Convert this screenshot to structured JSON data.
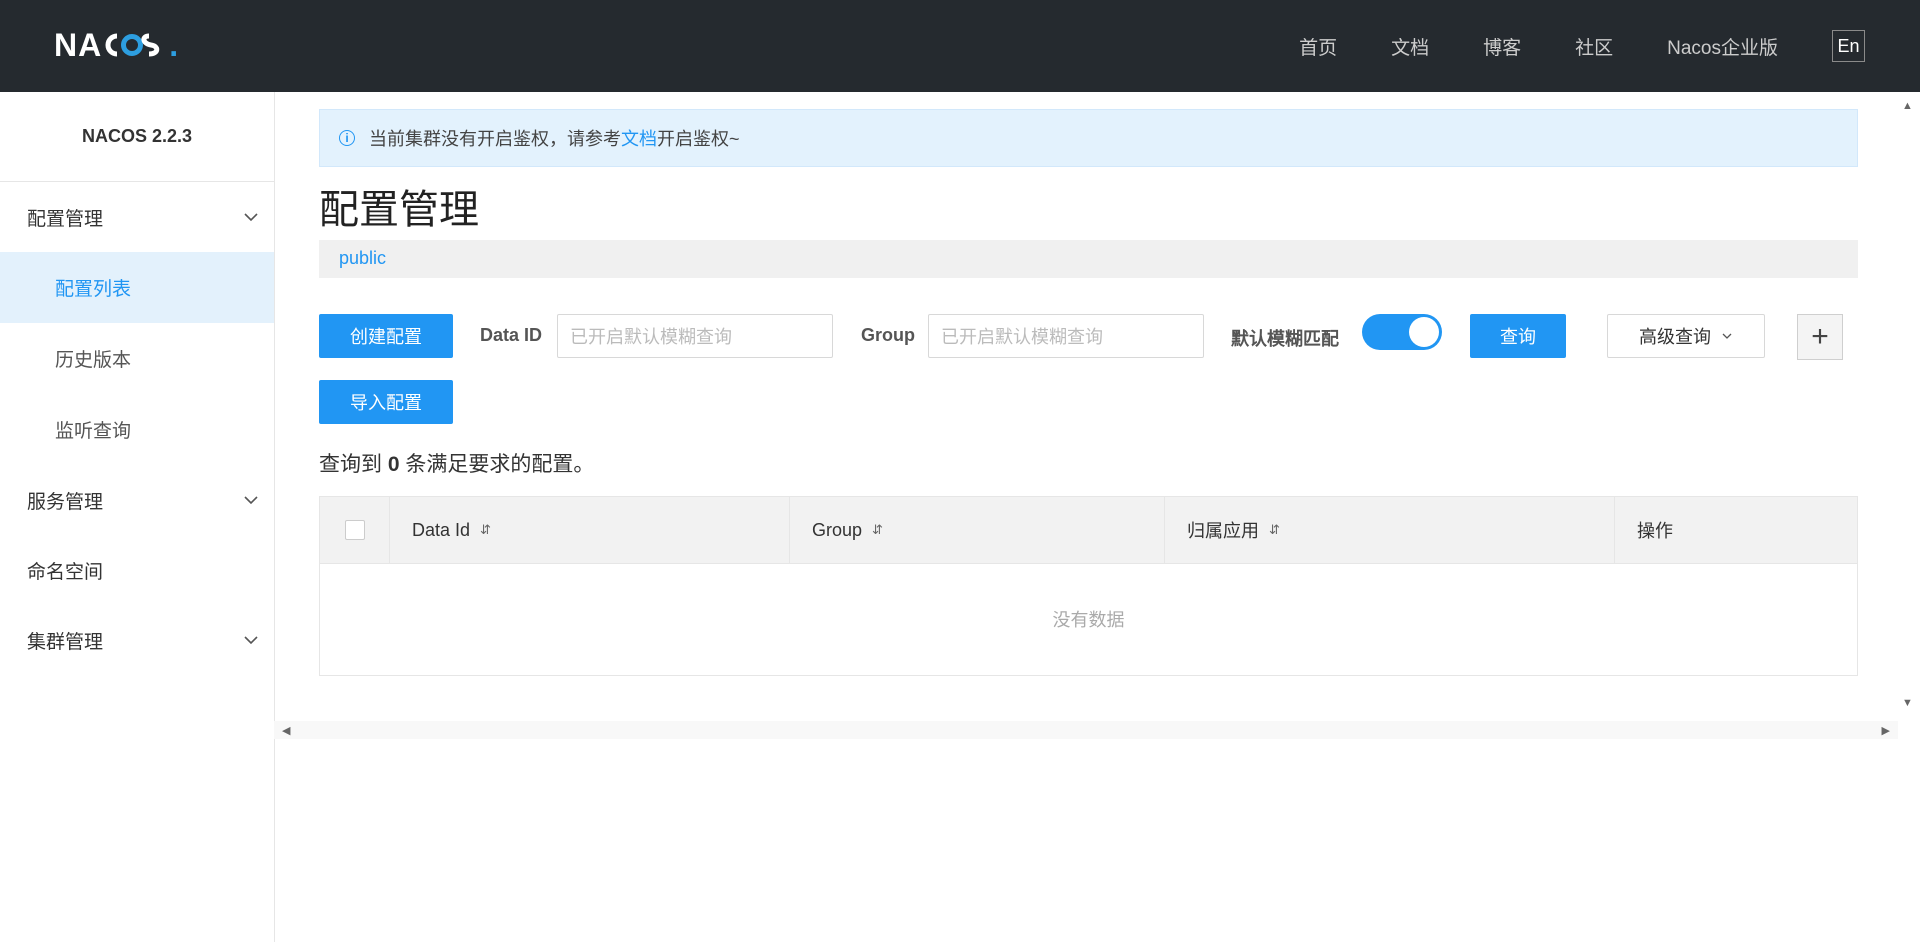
{
  "header": {
    "logo_left": "NA",
    "logo_co": "COS",
    "logo_dot": ".",
    "nav": [
      "首页",
      "文档",
      "博客",
      "社区",
      "Nacos企业版"
    ],
    "lang": "En"
  },
  "sidebar": {
    "version": "NACOS 2.2.3",
    "groups": [
      {
        "label": "配置管理"
      },
      {
        "label": "服务管理"
      },
      {
        "label": "命名空间"
      },
      {
        "label": "集群管理"
      }
    ],
    "config_items": [
      "配置列表",
      "历史版本",
      "监听查询"
    ]
  },
  "notice": {
    "text_before": "当前集群没有开启鉴权，请参考",
    "link": "文档",
    "text_after": "开启鉴权~"
  },
  "page_title": "配置管理",
  "namespace": "public",
  "toolbar": {
    "create_label": "创建配置",
    "data_id_label": "Data ID",
    "data_id_placeholder": "已开启默认模糊查询",
    "group_label": "Group",
    "group_placeholder": "已开启默认模糊查询",
    "fuzzy_label": "默认模糊匹配",
    "fuzzy_enabled": true,
    "query_label": "查询",
    "advanced_label": "高级查询",
    "import_label": "导入配置"
  },
  "result": {
    "prefix": "查询到",
    "count": "0",
    "suffix": "条满足要求的配置。"
  },
  "table": {
    "columns": [
      "Data Id",
      "Group",
      "归属应用",
      "操作"
    ],
    "empty": "没有数据"
  }
}
